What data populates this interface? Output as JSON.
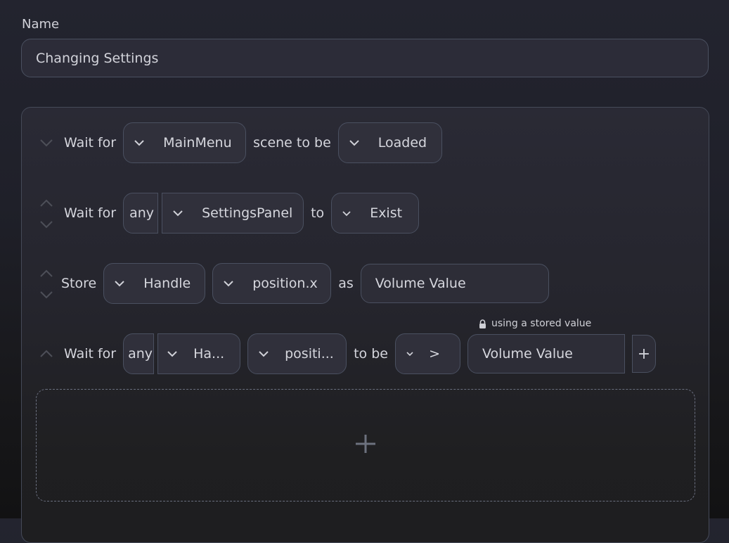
{
  "form": {
    "name_label": "Name",
    "name_value": "Changing Settings"
  },
  "steps": [
    {
      "verb": "Wait for",
      "target": "MainMenu",
      "connector": "scene to be",
      "state": "Loaded",
      "arrows": [
        "down"
      ]
    },
    {
      "verb": "Wait for",
      "quantifier": "any",
      "target": "SettingsPanel",
      "connector": "to",
      "state": "Exist",
      "arrows": [
        "up",
        "down"
      ]
    },
    {
      "verb": "Store",
      "target": "Handle",
      "property": "position.x",
      "connector": "as",
      "variable": "Volume Value",
      "arrows": [
        "up",
        "down"
      ]
    },
    {
      "verb": "Wait for",
      "quantifier": "any",
      "target": "Ha...",
      "property": "positi...",
      "connector": "to be",
      "operator": ">",
      "hint": "using a stored value",
      "value": "Volume Value",
      "add_label": "+",
      "arrows": [
        "up"
      ]
    }
  ],
  "add_step": {
    "icon": "plus-icon"
  },
  "icons": {
    "move_up": "chevron-up-icon",
    "move_down": "chevron-down-icon",
    "dropdown": "chevron-down-icon",
    "lock": "lock-icon"
  }
}
